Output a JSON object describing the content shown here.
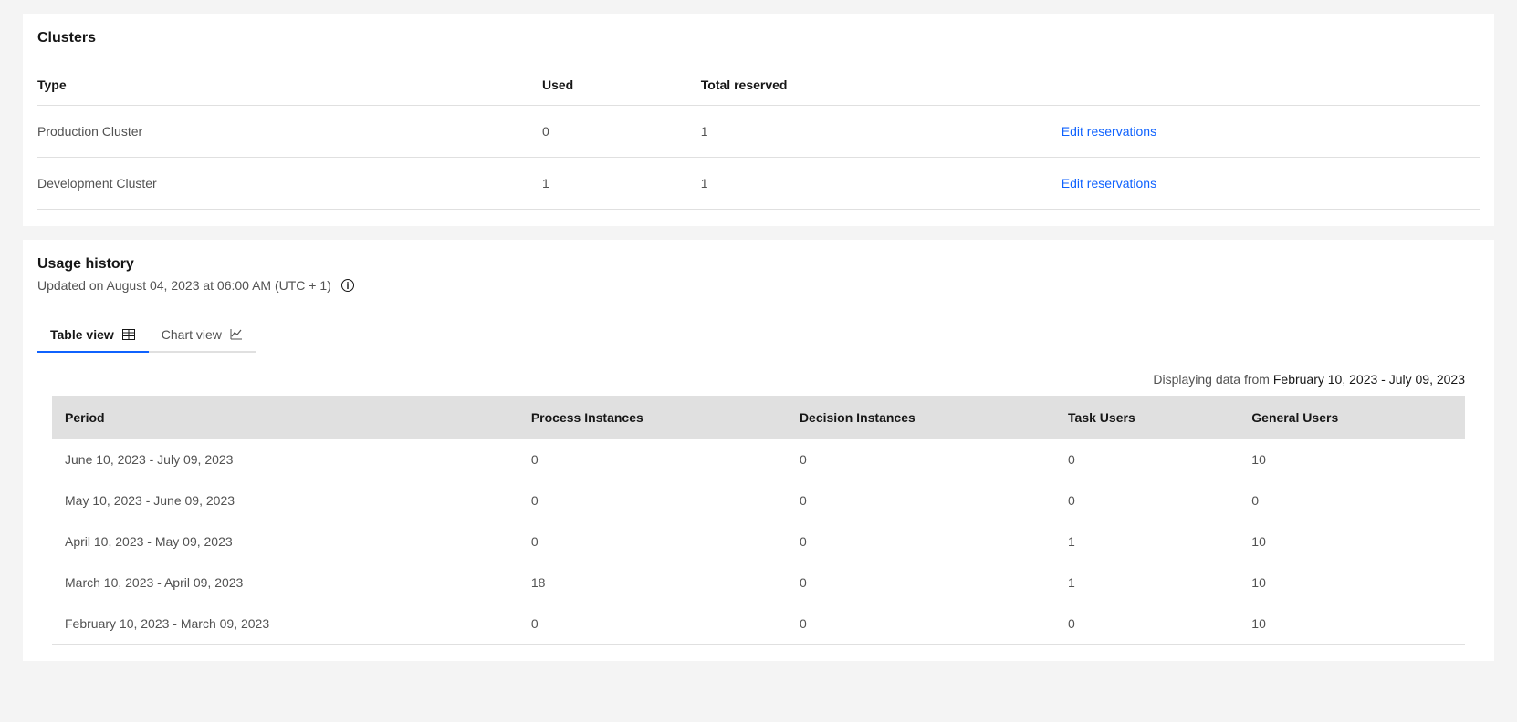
{
  "clusters": {
    "title": "Clusters",
    "headers": {
      "type": "Type",
      "used": "Used",
      "total": "Total reserved"
    },
    "rows": [
      {
        "type": "Production Cluster",
        "used": "0",
        "total": "1",
        "action": "Edit reservations"
      },
      {
        "type": "Development Cluster",
        "used": "1",
        "total": "1",
        "action": "Edit reservations"
      }
    ]
  },
  "usage": {
    "title": "Usage history",
    "subtitle": "Updated on August 04, 2023 at 06:00 AM (UTC + 1)",
    "tabs": {
      "table": "Table view",
      "chart": "Chart view"
    },
    "range_label": "Displaying data from ",
    "range_value": "February 10, 2023 - July 09, 2023",
    "headers": {
      "period": "Period",
      "process_instances": "Process Instances",
      "decision_instances": "Decision Instances",
      "task_users": "Task Users",
      "general_users": "General Users"
    },
    "rows": [
      {
        "period": "June 10, 2023 - July 09, 2023",
        "pi": "0",
        "di": "0",
        "tu": "0",
        "gu": "10"
      },
      {
        "period": "May 10, 2023 - June 09, 2023",
        "pi": "0",
        "di": "0",
        "tu": "0",
        "gu": "0"
      },
      {
        "period": "April 10, 2023 - May 09, 2023",
        "pi": "0",
        "di": "0",
        "tu": "1",
        "gu": "10"
      },
      {
        "period": "March 10, 2023 - April 09, 2023",
        "pi": "18",
        "di": "0",
        "tu": "1",
        "gu": "10"
      },
      {
        "period": "February 10, 2023 - March 09, 2023",
        "pi": "0",
        "di": "0",
        "tu": "0",
        "gu": "10"
      }
    ]
  }
}
